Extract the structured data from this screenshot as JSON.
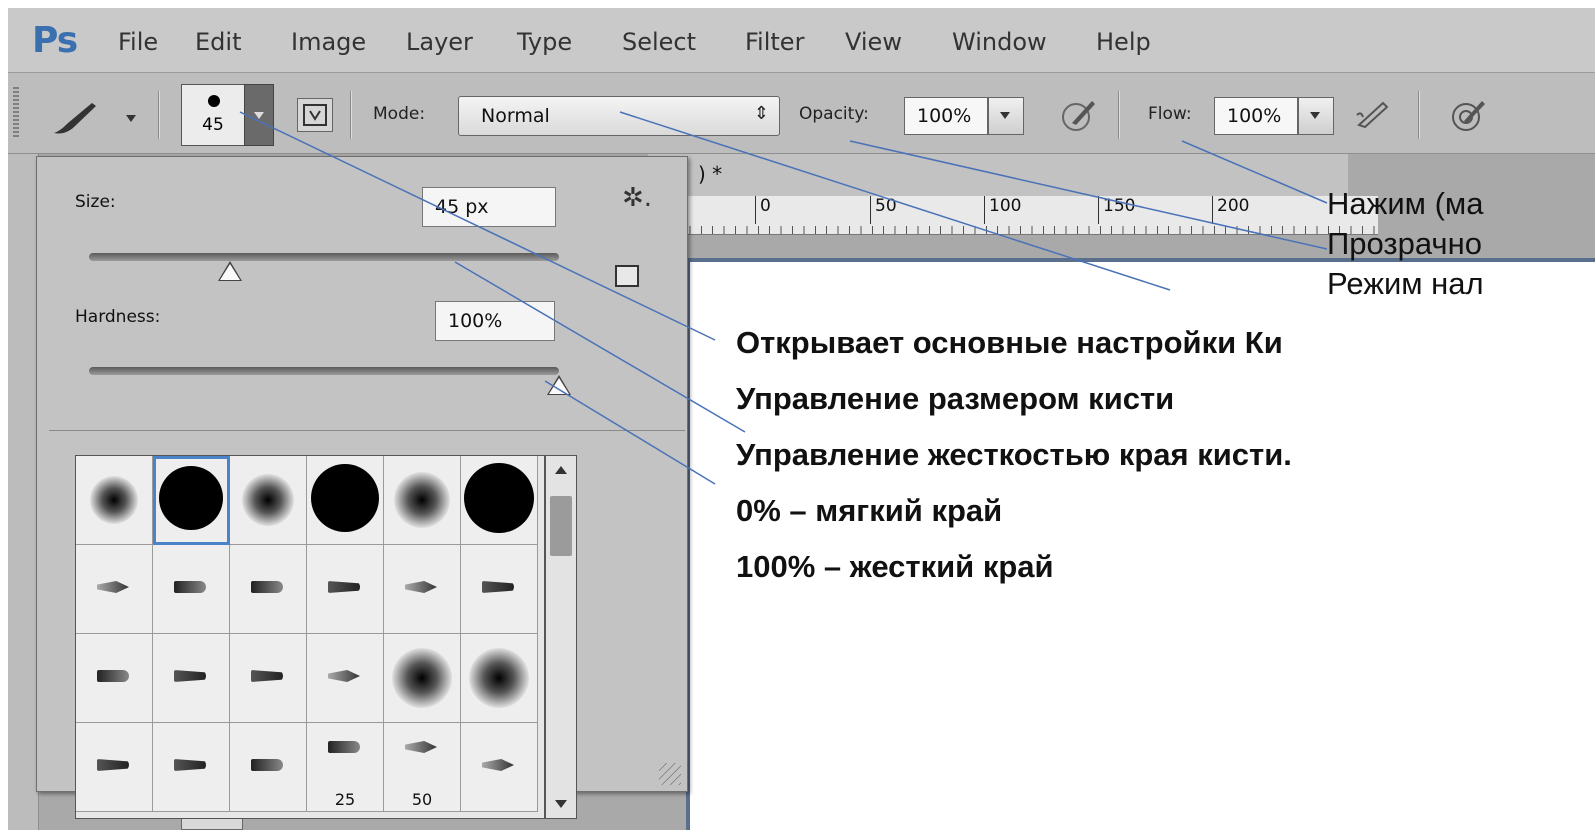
{
  "app": {
    "logo": "Ps"
  },
  "menu": [
    "File",
    "Edit",
    "Image",
    "Layer",
    "Type",
    "Select",
    "Filter",
    "View",
    "Window",
    "Help"
  ],
  "options_bar": {
    "preset_size": "45",
    "mode_label": "Mode:",
    "mode_value": "Normal",
    "mode_arrows": "⇕",
    "opacity_label": "Opacity:",
    "opacity_value": "100%",
    "flow_label": "Flow:",
    "flow_value": "100%"
  },
  "document": {
    "tab_title": ") *",
    "ruler_marks": [
      "0",
      "50",
      "100",
      "150",
      "200"
    ],
    "mini_box": "0"
  },
  "brush_picker": {
    "size_label": "Size:",
    "size_value": "45 px",
    "size_slider_fraction": 0.3,
    "hardness_label": "Hardness:",
    "hardness_value": "100%",
    "hardness_slider_fraction": 1.0,
    "gear_glyph": "✲.",
    "preset_numbers": [
      "25",
      "50"
    ]
  },
  "annotations": {
    "flow": "Нажим (ма",
    "opacity": "Прозрачно",
    "mode": "Режим нал",
    "open_settings": "Открывает основные настройки Ки",
    "size_control": "Управление размером кисти",
    "hardness_control": "Управление жесткостью края кисти.",
    "soft": "0% – мягкий край",
    "hard": "100% – жесткий край"
  },
  "colors": {
    "ps_blue": "#3a6fb0",
    "leader_line": "#4a72b8",
    "selection": "#4b83c8"
  }
}
